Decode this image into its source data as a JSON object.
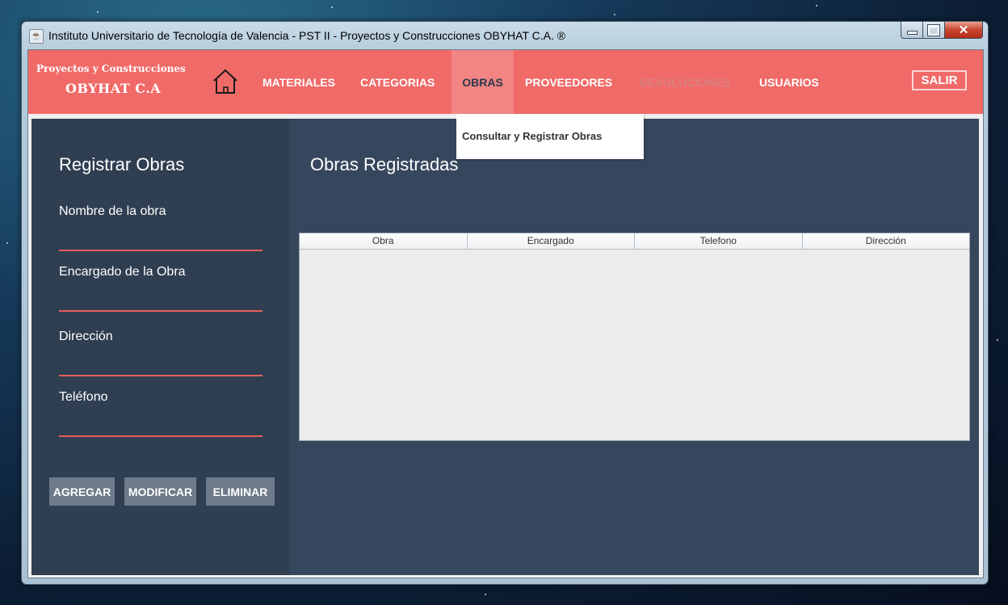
{
  "window": {
    "title": "Instituto Universitario de Tecnología de Valencia - PST II - Proyectos y Construcciones OBYHAT C.A. ®",
    "controls": {
      "minimize": "minimize",
      "maximize": "maximize",
      "close": "✕"
    }
  },
  "brand": {
    "line1": "Proyectos y Construcciones",
    "line2": "OBYHAT C.A"
  },
  "nav": {
    "items": [
      {
        "label": "MATERIALES"
      },
      {
        "label": "CATEGORIAS"
      },
      {
        "label": "OBRAS",
        "active": true
      },
      {
        "label": "PROVEEDORES"
      },
      {
        "label": "DEVOLUCIONES",
        "disabled": true
      },
      {
        "label": "USUARIOS"
      }
    ],
    "exit_label": "SALIR"
  },
  "dropdown": {
    "items": [
      "Consultar y Registrar Obras"
    ]
  },
  "form": {
    "title": "Registrar Obras",
    "fields": [
      {
        "label": "Nombre de la obra",
        "value": ""
      },
      {
        "label": "Encargado de la Obra",
        "value": ""
      },
      {
        "label": "Dirección",
        "value": ""
      },
      {
        "label": "Teléfono",
        "value": ""
      }
    ],
    "buttons": {
      "add": "AGREGAR",
      "modify": "MODIFICAR",
      "delete": "ELIMINAR"
    }
  },
  "table": {
    "title": "Obras Registradas",
    "columns": [
      "Obra",
      "Encargado",
      "Telefono",
      "Dirección"
    ],
    "rows": []
  },
  "colors": {
    "navbar": "#f06a68",
    "panel": "#36475d",
    "left_panel": "#2f3e51",
    "accent_underline": "#e5605d",
    "button": "#6d7a89"
  },
  "icons": {
    "home": "home-icon",
    "app": "java-icon"
  }
}
